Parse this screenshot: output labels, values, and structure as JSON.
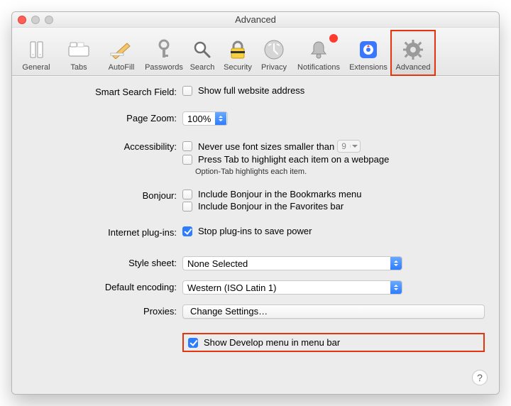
{
  "window": {
    "title": "Advanced"
  },
  "toolbar": {
    "items": [
      {
        "label": "General"
      },
      {
        "label": "Tabs"
      },
      {
        "label": "AutoFill"
      },
      {
        "label": "Passwords"
      },
      {
        "label": "Search"
      },
      {
        "label": "Security"
      },
      {
        "label": "Privacy"
      },
      {
        "label": "Notifications"
      },
      {
        "label": "Extensions"
      },
      {
        "label": "Advanced"
      }
    ]
  },
  "smartSearch": {
    "label": "Smart Search Field:",
    "optShowFull": "Show full website address"
  },
  "pageZoom": {
    "label": "Page Zoom:",
    "value": "100%"
  },
  "accessibility": {
    "label": "Accessibility:",
    "optFontSizes": "Never use font sizes smaller than",
    "fontSizeValue": "9",
    "optPressTab": "Press Tab to highlight each item on a webpage",
    "note": "Option-Tab highlights each item."
  },
  "bonjour": {
    "label": "Bonjour:",
    "optBookmarks": "Include Bonjour in the Bookmarks menu",
    "optFavorites": "Include Bonjour in the Favorites bar"
  },
  "plugins": {
    "label": "Internet plug-ins:",
    "optStop": "Stop plug-ins to save power"
  },
  "stylesheet": {
    "label": "Style sheet:",
    "value": "None Selected"
  },
  "encoding": {
    "label": "Default encoding:",
    "value": "Western (ISO Latin 1)"
  },
  "proxies": {
    "label": "Proxies:",
    "button": "Change Settings…"
  },
  "develop": {
    "label": "Show Develop menu in menu bar"
  },
  "help": {
    "glyph": "?"
  }
}
